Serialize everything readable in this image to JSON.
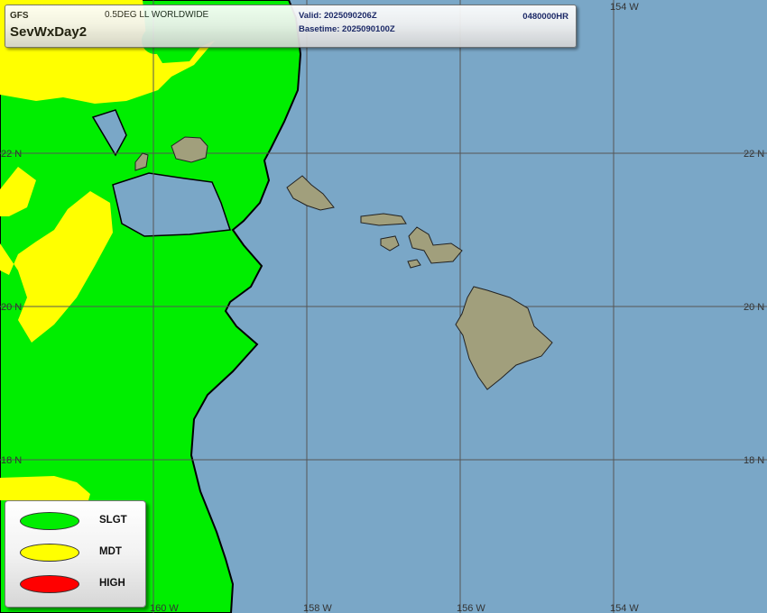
{
  "header": {
    "model": "GFS",
    "grid": "0.5DEG LL WORLDWIDE",
    "product": "SevWxDay2",
    "valid": "Valid: 2025090206Z",
    "basetime": "Basetime: 2025090100Z",
    "forecast_hour": "0480000HR"
  },
  "legend": {
    "items": [
      {
        "label": "SLGT",
        "color": "#00ee00"
      },
      {
        "label": "MDT",
        "color": "#ffff00"
      },
      {
        "label": "HIGH",
        "color": "#ff0000"
      }
    ]
  },
  "map": {
    "ocean_color": "#7aa7c7",
    "land_color": "#a19f7c",
    "grid_lines": {
      "longitudes": [
        "160 W",
        "158 W",
        "156 W",
        "154 W"
      ],
      "latitudes": [
        "22 N",
        "20 N",
        "18 N"
      ]
    }
  }
}
